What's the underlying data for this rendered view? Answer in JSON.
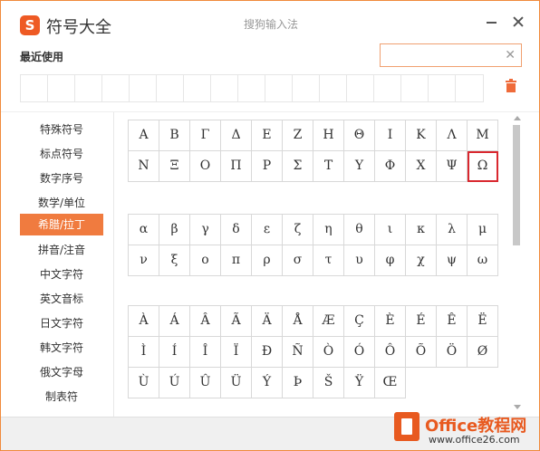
{
  "header": {
    "app_title": "符号大全",
    "center_title": "搜狗输入法",
    "logo_glyph": "S"
  },
  "recent": {
    "label": "最近使用",
    "cell_count": 17
  },
  "search": {
    "value": "",
    "placeholder": ""
  },
  "categories": [
    {
      "label": "特殊符号",
      "active": false
    },
    {
      "label": "标点符号",
      "active": false
    },
    {
      "label": "数字序号",
      "active": false
    },
    {
      "label": "数学/单位",
      "active": false
    },
    {
      "label": "希腊/拉丁",
      "active": true
    },
    {
      "label": "拼音/注音",
      "active": false
    },
    {
      "label": "中文字符",
      "active": false
    },
    {
      "label": "英文音标",
      "active": false
    },
    {
      "label": "日文字符",
      "active": false
    },
    {
      "label": "韩文字符",
      "active": false
    },
    {
      "label": "俄文字母",
      "active": false
    },
    {
      "label": "制表符",
      "active": false
    }
  ],
  "symbol_groups": [
    {
      "name": "greek_upper",
      "symbols": [
        "Α",
        "Β",
        "Γ",
        "Δ",
        "Ε",
        "Ζ",
        "Η",
        "Θ",
        "Ι",
        "Κ",
        "Λ",
        "Μ",
        "Ν",
        "Ξ",
        "Ο",
        "Π",
        "Ρ",
        "Σ",
        "Τ",
        "Υ",
        "Φ",
        "Χ",
        "Ψ",
        "Ω"
      ],
      "selected": "Ω"
    },
    {
      "name": "greek_lower",
      "symbols": [
        "α",
        "β",
        "γ",
        "δ",
        "ε",
        "ζ",
        "η",
        "θ",
        "ι",
        "κ",
        "λ",
        "μ",
        "ν",
        "ξ",
        "ο",
        "π",
        "ρ",
        "σ",
        "τ",
        "υ",
        "φ",
        "χ",
        "ψ",
        "ω"
      ],
      "selected": null
    },
    {
      "name": "latin_extended",
      "symbols": [
        "À",
        "Á",
        "Â",
        "Ã",
        "Ä",
        "Å",
        "Æ",
        "Ç",
        "È",
        "É",
        "Ê",
        "Ë",
        "Ì",
        "Í",
        "Î",
        "Ï",
        "Ð",
        "Ñ",
        "Ò",
        "Ó",
        "Ô",
        "Õ",
        "Ö",
        "Ø",
        "Ù",
        "Ú",
        "Û",
        "Ü",
        "Ý",
        "Þ",
        "Š",
        "Ÿ",
        "Œ"
      ],
      "selected": null
    }
  ],
  "watermark": {
    "brand": "Office教程网",
    "url": "www.office26.com"
  },
  "colors": {
    "accent": "#f07b3f",
    "selection": "#d9282f",
    "border": "#f08a3c"
  }
}
